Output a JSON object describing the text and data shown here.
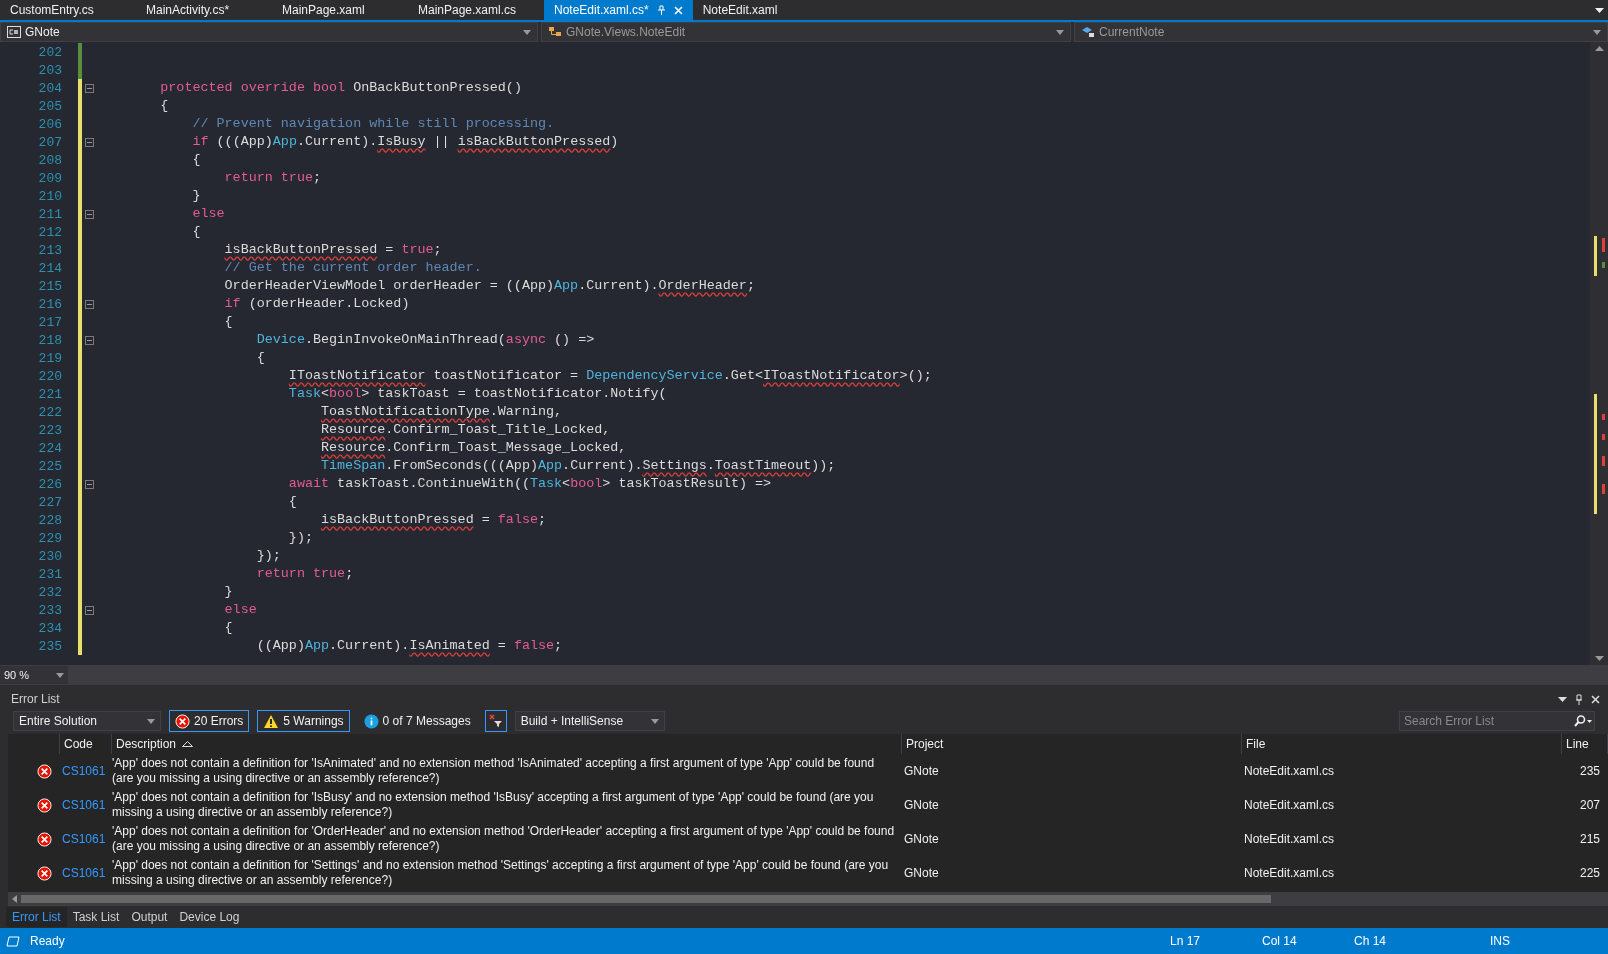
{
  "tabs": [
    {
      "label": "CustomEntry.cs",
      "selected": false
    },
    {
      "label": "MainActivity.cs*",
      "selected": false
    },
    {
      "label": "MainPage.xaml",
      "selected": false
    },
    {
      "label": "MainPage.xaml.cs",
      "selected": false
    },
    {
      "label": "NoteEdit.xaml.cs*",
      "selected": true
    },
    {
      "label": "NoteEdit.xaml",
      "selected": false
    }
  ],
  "navigation": {
    "project": "GNote",
    "type": "GNote.Views.NoteEdit",
    "member": "CurrentNote"
  },
  "editor": {
    "zoom": "90 %",
    "lines": [
      {
        "number": "202",
        "modified": false,
        "foldable": false
      },
      {
        "number": "203",
        "modified": false,
        "foldable": false
      },
      {
        "number": "204",
        "modified": true,
        "foldable": true,
        "tokens": [
          {
            "text": "        protected override bool",
            "kind": "keyword"
          },
          {
            "text": " OnBackButtonPressed()",
            "kind": "plain"
          }
        ]
      },
      {
        "number": "205",
        "modified": true,
        "foldable": false,
        "tokens": [
          {
            "text": "        {",
            "kind": "plain"
          }
        ]
      },
      {
        "number": "206",
        "modified": true,
        "foldable": false,
        "tokens": [
          {
            "text": "            // Prevent navigation while still processing.",
            "kind": "comment"
          }
        ]
      },
      {
        "number": "207",
        "modified": true,
        "foldable": true,
        "tokens": [
          {
            "text": "            if",
            "kind": "keyword"
          },
          {
            "text": " (((App)",
            "kind": "plain"
          },
          {
            "text": "App",
            "kind": "type"
          },
          {
            "text": ".Current).",
            "kind": "plain"
          },
          {
            "text": "IsBusy",
            "kind": "error"
          },
          {
            "text": " || ",
            "kind": "plain"
          },
          {
            "text": "isBackButtonPressed",
            "kind": "error"
          },
          {
            "text": ")",
            "kind": "plain"
          }
        ]
      },
      {
        "number": "208",
        "modified": true,
        "foldable": false,
        "tokens": [
          {
            "text": "            {",
            "kind": "plain"
          }
        ]
      },
      {
        "number": "209",
        "modified": true,
        "foldable": false,
        "tokens": [
          {
            "text": "                return true",
            "kind": "keyword"
          },
          {
            "text": ";",
            "kind": "plain"
          }
        ]
      },
      {
        "number": "210",
        "modified": true,
        "foldable": false,
        "tokens": [
          {
            "text": "            }",
            "kind": "plain"
          }
        ]
      },
      {
        "number": "211",
        "modified": true,
        "foldable": true,
        "tokens": [
          {
            "text": "            else",
            "kind": "keyword"
          }
        ]
      },
      {
        "number": "212",
        "modified": true,
        "foldable": false,
        "tokens": [
          {
            "text": "            {",
            "kind": "plain"
          }
        ]
      },
      {
        "number": "213",
        "modified": true,
        "foldable": false,
        "tokens": [
          {
            "text": "                isBackButtonPressed",
            "kind": "error"
          },
          {
            "text": " = ",
            "kind": "plain"
          },
          {
            "text": "true",
            "kind": "keyword"
          },
          {
            "text": ";",
            "kind": "plain"
          }
        ]
      },
      {
        "number": "214",
        "modified": true,
        "foldable": false,
        "tokens": [
          {
            "text": "                // Get the current order header.",
            "kind": "comment"
          }
        ]
      },
      {
        "number": "215",
        "modified": true,
        "foldable": false,
        "tokens": [
          {
            "text": "                OrderHeaderViewModel orderHeader = ((App)",
            "kind": "plain"
          },
          {
            "text": "App",
            "kind": "type"
          },
          {
            "text": ".Current).",
            "kind": "plain"
          },
          {
            "text": "OrderHeader",
            "kind": "error"
          },
          {
            "text": ";",
            "kind": "plain"
          }
        ]
      },
      {
        "number": "216",
        "modified": true,
        "foldable": true,
        "tokens": [
          {
            "text": "                if",
            "kind": "keyword"
          },
          {
            "text": " (orderHeader.Locked)",
            "kind": "plain"
          }
        ]
      },
      {
        "number": "217",
        "modified": true,
        "foldable": false,
        "tokens": [
          {
            "text": "                {",
            "kind": "plain"
          }
        ]
      },
      {
        "number": "218",
        "modified": true,
        "foldable": true,
        "tokens": [
          {
            "text": "                    Device",
            "kind": "type"
          },
          {
            "text": ".BeginInvokeOnMainThread(",
            "kind": "plain"
          },
          {
            "text": "async",
            "kind": "keyword"
          },
          {
            "text": " () =>",
            "kind": "plain"
          }
        ]
      },
      {
        "number": "219",
        "modified": true,
        "foldable": false,
        "tokens": [
          {
            "text": "                    {",
            "kind": "plain"
          }
        ]
      },
      {
        "number": "220",
        "modified": true,
        "foldable": false,
        "tokens": [
          {
            "text": "                        IToastNotificator",
            "kind": "error"
          },
          {
            "text": " toastNotificator = ",
            "kind": "plain"
          },
          {
            "text": "DependencyService",
            "kind": "type"
          },
          {
            "text": ".Get<",
            "kind": "plain"
          },
          {
            "text": "IToastNotificator",
            "kind": "error"
          },
          {
            "text": ">();",
            "kind": "plain"
          }
        ]
      },
      {
        "number": "221",
        "modified": true,
        "foldable": false,
        "tokens": [
          {
            "text": "                        Task",
            "kind": "type"
          },
          {
            "text": "<",
            "kind": "plain"
          },
          {
            "text": "bool",
            "kind": "keyword"
          },
          {
            "text": "> taskToast = toastNotificator.Notify(",
            "kind": "plain"
          }
        ]
      },
      {
        "number": "222",
        "modified": true,
        "foldable": false,
        "tokens": [
          {
            "text": "                            ToastNotificationType",
            "kind": "error"
          },
          {
            "text": ".Warning,",
            "kind": "plain"
          }
        ]
      },
      {
        "number": "223",
        "modified": true,
        "foldable": false,
        "tokens": [
          {
            "text": "                            Resource",
            "kind": "error"
          },
          {
            "text": ".Confirm_Toast_Title_Locked,",
            "kind": "plain"
          }
        ]
      },
      {
        "number": "224",
        "modified": true,
        "foldable": false,
        "tokens": [
          {
            "text": "                            Resource",
            "kind": "error"
          },
          {
            "text": ".Confirm_Toast_Message_Locked,",
            "kind": "plain"
          }
        ]
      },
      {
        "number": "225",
        "modified": true,
        "foldable": false,
        "tokens": [
          {
            "text": "                            TimeSpan",
            "kind": "type"
          },
          {
            "text": ".FromSeconds(((App)",
            "kind": "plain"
          },
          {
            "text": "App",
            "kind": "type"
          },
          {
            "text": ".Current).",
            "kind": "plain"
          },
          {
            "text": "Settings",
            "kind": "error"
          },
          {
            "text": ".",
            "kind": "plain"
          },
          {
            "text": "ToastTimeout",
            "kind": "error"
          },
          {
            "text": "));",
            "kind": "plain"
          }
        ]
      },
      {
        "number": "226",
        "modified": true,
        "foldable": true,
        "tokens": [
          {
            "text": "                        await",
            "kind": "keyword"
          },
          {
            "text": " taskToast.ContinueWith((",
            "kind": "plain"
          },
          {
            "text": "Task",
            "kind": "type"
          },
          {
            "text": "<",
            "kind": "plain"
          },
          {
            "text": "bool",
            "kind": "keyword"
          },
          {
            "text": "> taskToastResult) =>",
            "kind": "plain"
          }
        ]
      },
      {
        "number": "227",
        "modified": true,
        "foldable": false,
        "tokens": [
          {
            "text": "                        {",
            "kind": "plain"
          }
        ]
      },
      {
        "number": "228",
        "modified": true,
        "foldable": false,
        "tokens": [
          {
            "text": "                            isBackButtonPressed",
            "kind": "error"
          },
          {
            "text": " = ",
            "kind": "plain"
          },
          {
            "text": "false",
            "kind": "keyword"
          },
          {
            "text": ";",
            "kind": "plain"
          }
        ]
      },
      {
        "number": "229",
        "modified": true,
        "foldable": false,
        "tokens": [
          {
            "text": "                        });",
            "kind": "plain"
          }
        ]
      },
      {
        "number": "230",
        "modified": true,
        "foldable": false,
        "tokens": [
          {
            "text": "                    });",
            "kind": "plain"
          }
        ]
      },
      {
        "number": "231",
        "modified": true,
        "foldable": false,
        "tokens": [
          {
            "text": "                    return true",
            "kind": "keyword"
          },
          {
            "text": ";",
            "kind": "plain"
          }
        ]
      },
      {
        "number": "232",
        "modified": true,
        "foldable": false,
        "tokens": [
          {
            "text": "                }",
            "kind": "plain"
          }
        ]
      },
      {
        "number": "233",
        "modified": true,
        "foldable": true,
        "tokens": [
          {
            "text": "                else",
            "kind": "keyword"
          }
        ]
      },
      {
        "number": "234",
        "modified": true,
        "foldable": false,
        "tokens": [
          {
            "text": "                {",
            "kind": "plain"
          }
        ]
      },
      {
        "number": "235",
        "modified": true,
        "foldable": false,
        "tokens": [
          {
            "text": "                    ((App)",
            "kind": "plain"
          },
          {
            "text": "App",
            "kind": "type"
          },
          {
            "text": ".Current).",
            "kind": "plain"
          },
          {
            "text": "IsAnimated",
            "kind": "error"
          },
          {
            "text": " = ",
            "kind": "plain"
          },
          {
            "text": "false",
            "kind": "keyword"
          },
          {
            "text": ";",
            "kind": "plain"
          }
        ]
      }
    ]
  },
  "error_list": {
    "title": "Error List",
    "scope": "Entire Solution",
    "filters": [
      {
        "kind": "error",
        "label": "20 Errors",
        "selected": true
      },
      {
        "kind": "warning",
        "label": "5 Warnings",
        "selected": true
      },
      {
        "kind": "message",
        "label": "0 of 7 Messages",
        "selected": false
      }
    ],
    "source": "Build + IntelliSense",
    "search": {
      "placeholder": "Search Error List"
    },
    "columns": [
      {
        "label": "Code",
        "sorted": false
      },
      {
        "label": "Description",
        "sorted": true
      },
      {
        "label": "Project",
        "sorted": false
      },
      {
        "label": "File",
        "sorted": false
      },
      {
        "label": "Line",
        "sorted": false
      }
    ],
    "rows": [
      {
        "code": "CS1061",
        "description": "'App' does not contain a definition for 'IsAnimated' and no extension method 'IsAnimated' accepting a first argument of type 'App' could be found (are you missing a using directive or an assembly reference?)",
        "project": "GNote",
        "file": "NoteEdit.xaml.cs",
        "line": "235"
      },
      {
        "code": "CS1061",
        "description": "'App' does not contain a definition for 'IsBusy' and no extension method 'IsBusy' accepting a first argument of type 'App' could be found (are you missing a using directive or an assembly reference?)",
        "project": "GNote",
        "file": "NoteEdit.xaml.cs",
        "line": "207"
      },
      {
        "code": "CS1061",
        "description": "'App' does not contain a definition for 'OrderHeader' and no extension method 'OrderHeader' accepting a first argument of type 'App' could be found (are you missing a using directive or an assembly reference?)",
        "project": "GNote",
        "file": "NoteEdit.xaml.cs",
        "line": "215"
      },
      {
        "code": "CS1061",
        "description": "'App' does not contain a definition for 'Settings' and no extension method 'Settings' accepting a first argument of type 'App' could be found (are you missing a using directive or an assembly reference?)",
        "project": "GNote",
        "file": "NoteEdit.xaml.cs",
        "line": "225"
      }
    ]
  },
  "panel_tabs": [
    {
      "label": "Error List",
      "selected": true
    },
    {
      "label": "Task List",
      "selected": false
    },
    {
      "label": "Output",
      "selected": false
    },
    {
      "label": "Device Log",
      "selected": false
    }
  ],
  "status_bar": {
    "message": "Ready",
    "line": "Ln 17",
    "column": "Col 14",
    "char": "Ch 14",
    "mode": "INS"
  }
}
